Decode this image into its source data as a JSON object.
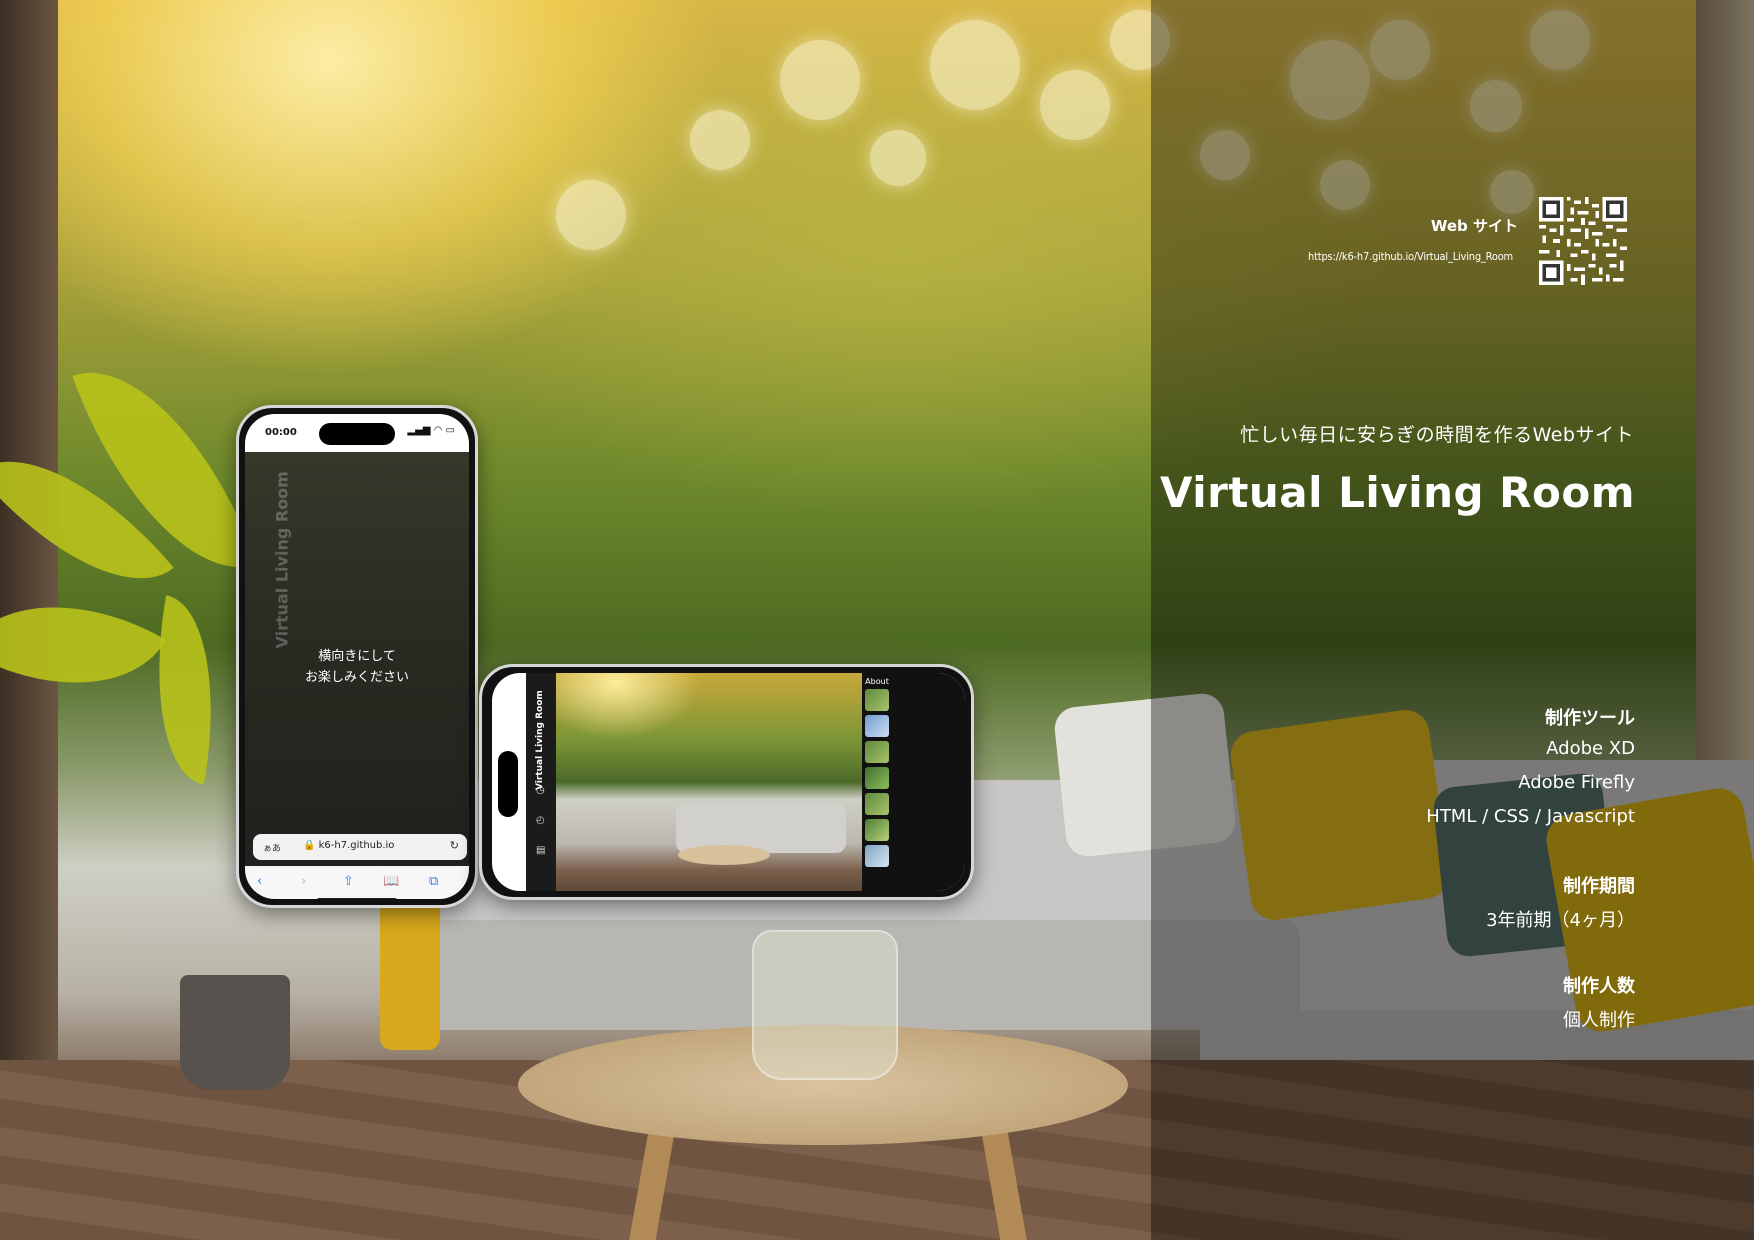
{
  "website": {
    "label": "Web サイト",
    "url": "https://k6-h7.github.io/Virtual_Living_Room"
  },
  "project": {
    "tagline": "忙しい毎日に安らぎの時間を作るWebサイト",
    "title": "Virtual Living Room"
  },
  "details": {
    "tools_heading": "制作ツール",
    "tools": [
      "Adobe XD",
      "Adobe Firefly",
      "HTML / CSS / Javascript"
    ],
    "period_heading": "制作期間",
    "period": "3年前期（4ヶ月）",
    "team_heading": "制作人数",
    "team": "個人制作"
  },
  "portrait_phone": {
    "time": "00:00",
    "status_icons": "▂▄▆ ◠ ▭",
    "vertical_title": "Virtual Living Room",
    "message_line1": "横向きにして",
    "message_line2": "お楽しみください",
    "url_aa": "ぁあ",
    "url_domain": "🔒 k6-h7.github.io",
    "reload_icon": "↻",
    "toolbar_icons": [
      "‹",
      "›",
      "⇧",
      "📖",
      "⧉"
    ]
  },
  "landscape_phone": {
    "vertical_title": "Virtual Living Room",
    "about_label": "About",
    "side_icons": [
      "◷",
      "◴",
      "▤"
    ]
  },
  "colors": {
    "panel_overlay": "rgba(0,0,0,0.38)",
    "text": "#ffffff",
    "ios_blue": "#2e7cf6"
  }
}
